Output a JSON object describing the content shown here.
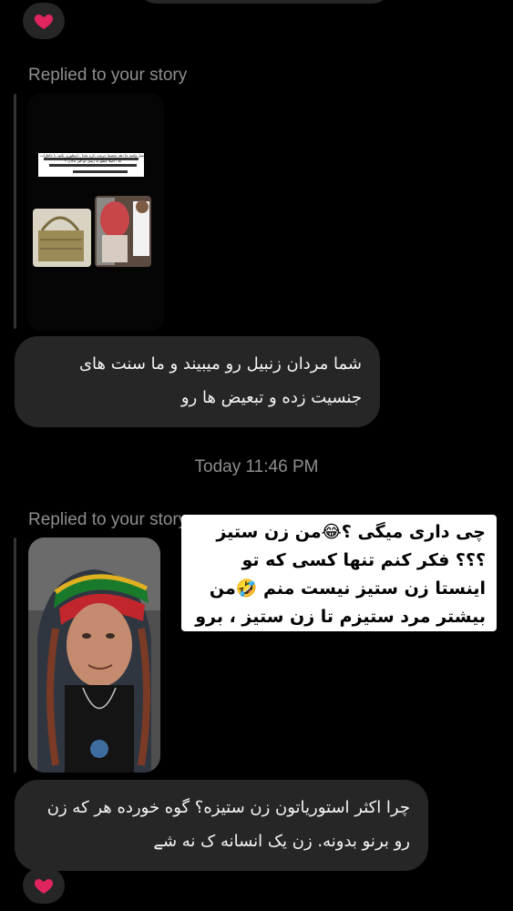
{
  "messages": {
    "first_reply_label": "Replied to your story",
    "first_story_caption": "زنبیل واسه ما دهه شصتیا حرمت داره بخدا ، اینطوری نکنید با خاطرات ما ، اصلا چطو به زنبیل تو گیر ندادن ؟",
    "first_bubble": "شما مردان زنبیل رو میبیند و ما سنت های جنسیت زده و تبعیض ها رو",
    "timestamp": "Today 11:46 PM",
    "second_reply_label": "Replied to your story",
    "overlay_text": "چی داری میگی ؟😂من زن ستیز ؟؟؟ فکر کنم تنها کسی که تو اینستا زن ستیز نیست منم 🤣من بیشتر مرد ستیزم تا زن ستیز ، برو کلیپامو ببین 😂😂",
    "second_bubble": "چرا اکثر استوریاتون زن ستیزه؟ گوه خورده هر که زن رو برنو بدونه. زن یک انسانه ک نه شے"
  },
  "icons": {
    "reaction": "red-heart-icon"
  },
  "colors": {
    "background": "#000000",
    "bubble": "#262626",
    "meta_text": "#8e8e8e",
    "heart": "#e0245e"
  }
}
